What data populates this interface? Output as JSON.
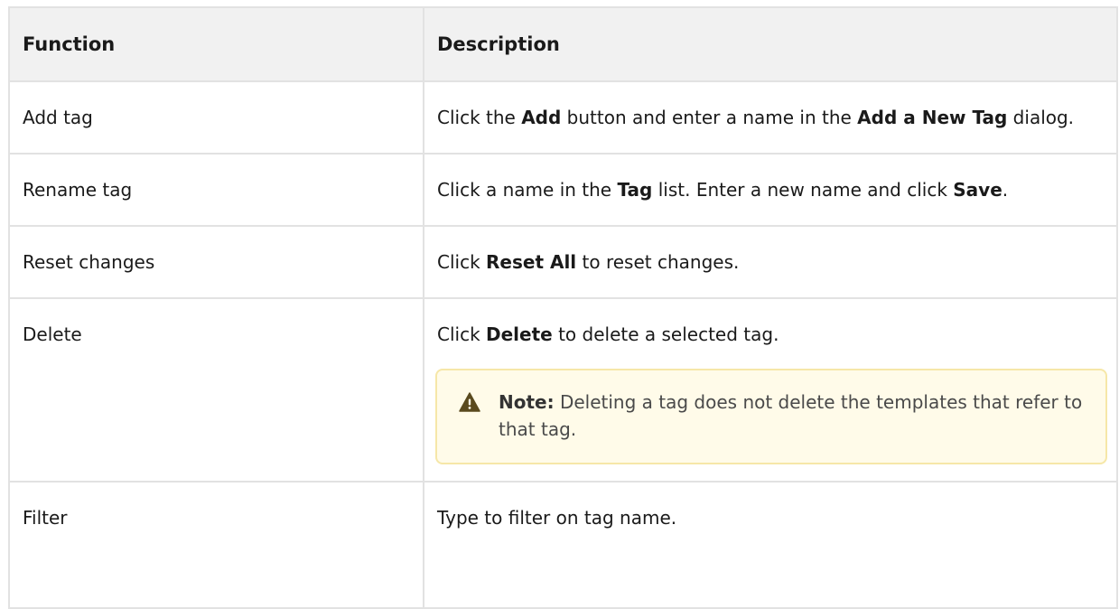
{
  "table": {
    "headers": {
      "function": "Function",
      "description": "Description"
    },
    "rows": [
      {
        "function": "Add tag",
        "desc": {
          "p1": "Click the ",
          "b1": "Add",
          "p2": " button and enter a name in the ",
          "b2": "Add a New Tag",
          "p3": " dialog."
        }
      },
      {
        "function": "Rename tag",
        "desc": {
          "p1": "Click a name in the ",
          "b1": "Tag",
          "p2": " list. Enter a new name and click ",
          "b2": "Save",
          "p3": "."
        }
      },
      {
        "function": "Reset changes",
        "desc": {
          "p1": "Click ",
          "b1": "Reset All",
          "p2": " to reset changes."
        }
      },
      {
        "function": "Delete",
        "desc": {
          "p1": "Click ",
          "b1": "Delete",
          "p2": " to delete a selected tag."
        },
        "note": {
          "label": "Note:",
          "text": " Deleting a tag does not delete the templates that refer to that tag.",
          "icon": "warning-icon",
          "color": "#5a4a1e"
        }
      },
      {
        "function": "Filter",
        "desc": {
          "p1": "Type to filter on tag name."
        }
      }
    ]
  }
}
